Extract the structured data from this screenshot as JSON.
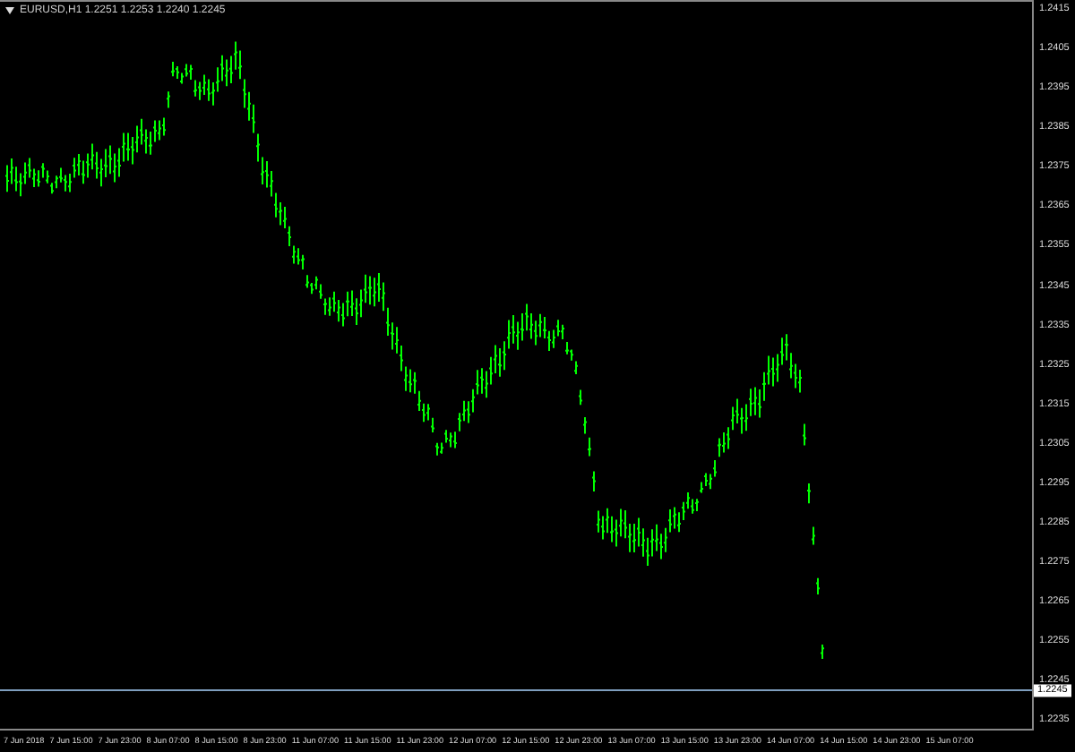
{
  "header": {
    "text": "EURUSD,H1 1.2251 1.2253 1.2240 1.2245"
  },
  "price_axis": {
    "labels": [
      "1.2415",
      "1.2405",
      "1.2395",
      "1.2385",
      "1.2375",
      "1.2365",
      "1.2355",
      "1.2345",
      "1.2335",
      "1.2325",
      "1.2315",
      "1.2305",
      "1.2295",
      "1.2285",
      "1.2275",
      "1.2265",
      "1.2255",
      "1.2245",
      "1.2235"
    ],
    "current_price": "1.2245"
  },
  "time_axis": {
    "labels": [
      "7 Jun 2018",
      "7 Jun 15:00",
      "7 Jun 23:00",
      "8 Jun 07:00",
      "8 Jun 15:00",
      "8 Jun 23:00",
      "11 Jun 07:00",
      "11 Jun 15:00",
      "11 Jun 23:00",
      "12 Jun 07:00",
      "12 Jun 15:00",
      "12 Jun 23:00",
      "13 Jun 07:00",
      "13 Jun 15:00",
      "13 Jun 23:00",
      "14 Jun 07:00",
      "14 Jun 15:00",
      "14 Jun 23:00",
      "15 Jun 07:00"
    ]
  }
}
